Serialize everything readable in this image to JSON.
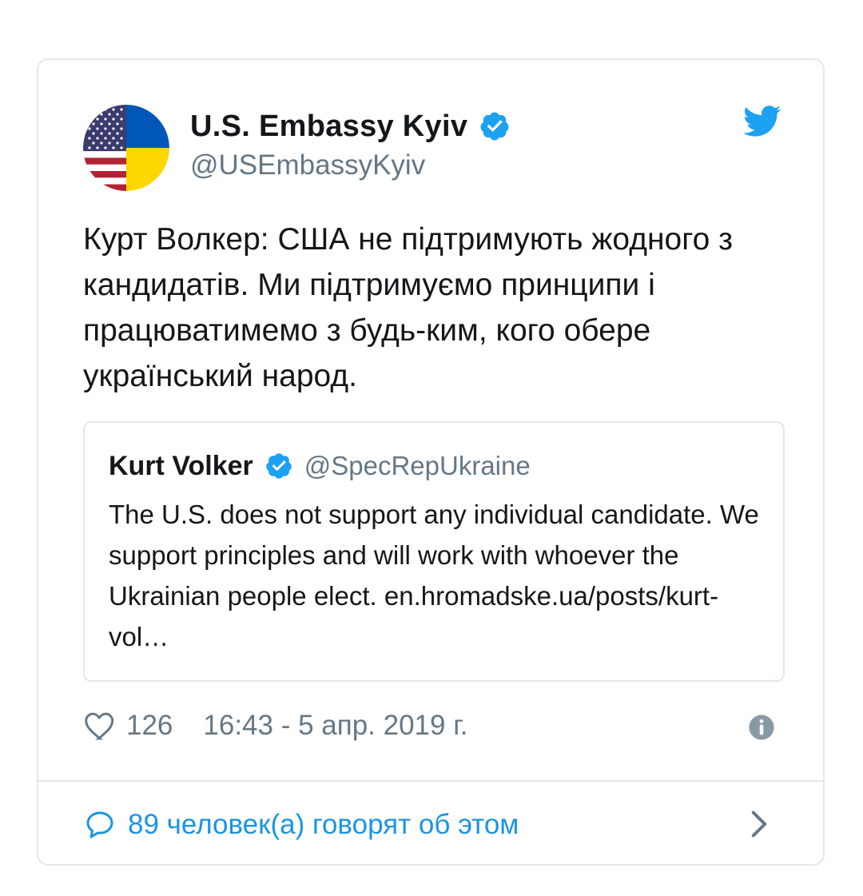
{
  "tweet": {
    "author": {
      "display_name": "U.S. Embassy Kyiv",
      "handle": "@USEmbassyKyiv",
      "verified": true,
      "avatar": "us-ukraine-flag-avatar"
    },
    "text": "Курт Волкер: США не підтримують жодного з кандидатів. Ми підтримуємо принципи і працюватимемо з будь-ким, кого обере український народ.",
    "quoted_tweet": {
      "display_name": "Kurt Volker",
      "handle": "@SpecRepUkraine",
      "verified": true,
      "text": "The U.S. does not support any individual candidate. We support principles and will work with whoever the Ukrainian people elect. en.hromadske.ua/posts/kurt-vol…"
    },
    "likes": "126",
    "timestamp": "16:43 - 5 апр. 2019 г.",
    "conversation_link": "89 человек(а) говорят об этом"
  },
  "colors": {
    "text": "#14171a",
    "secondary": "#657786",
    "accent": "#1b95e0",
    "verified": "#1da1f2",
    "border": "#e1e8ed"
  },
  "icons": {
    "brand": "twitter-bird-icon",
    "verified": "verified-badge-icon",
    "like": "heart-icon",
    "info": "info-icon",
    "conversation": "speech-bubble-icon",
    "open": "chevron-right-icon"
  }
}
